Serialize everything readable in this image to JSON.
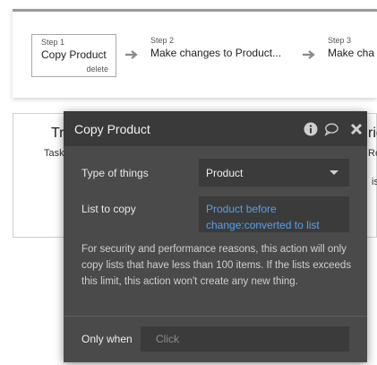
{
  "workflow": {
    "steps": [
      {
        "number": "Step 1",
        "title": "Copy Product",
        "action": "delete"
      },
      {
        "number": "Step 2",
        "title": "Make changes to Product..."
      },
      {
        "number": "Step 3",
        "title": "Make cha"
      }
    ]
  },
  "background_card": {
    "left_title": "Tr",
    "left_sub": "Task",
    "right_title": "rig",
    "right_sub": "Re",
    "right_sub2": "is"
  },
  "dialog": {
    "title": "Copy Product",
    "icons": [
      "info-icon",
      "comment-icon",
      "close-icon"
    ],
    "type_label": "Type of things",
    "type_value": "Product",
    "list_label": "List to copy",
    "list_value_line1": "Product before",
    "list_value_line2": "change:converted to list",
    "note": "For security and performance reasons, this action will only copy lists that have less than 100 items. If the lists exceeds this limit, this action won't create any new thing.",
    "only_when_label": "Only when",
    "only_when_placeholder": "Click"
  },
  "colors": {
    "dialog_bg": "#4a4a4a",
    "header_bg": "#3a3a3a",
    "field_bg": "#3b3b3b",
    "expression": "#5aa0e6"
  }
}
